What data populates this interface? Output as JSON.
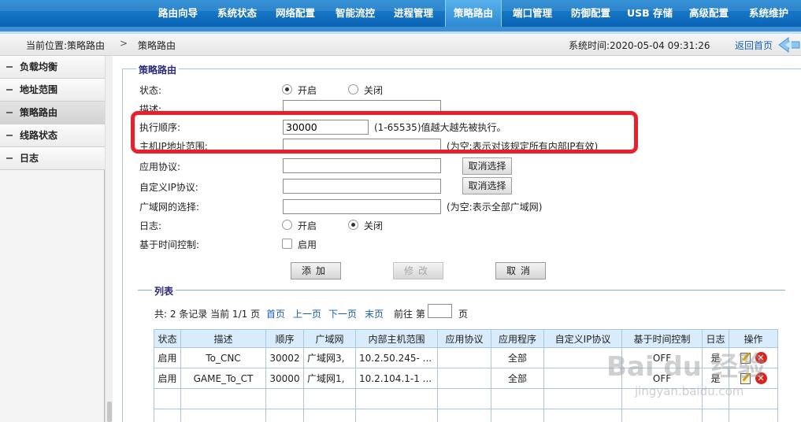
{
  "nav": {
    "items": [
      "路由向导",
      "系统状态",
      "网络配置",
      "智能流控",
      "进程管理",
      "策略路由",
      "端口管理",
      "防御配置",
      "USB 存储",
      "高级配置",
      "系统维护"
    ],
    "active": "策略路由"
  },
  "breadcrumb": {
    "current_label": "当前位置:策略路由",
    "separator": ">",
    "page": "策略路由"
  },
  "system_time": "系统时间:2020-05-04 09:31:26",
  "back_home": "返回首页",
  "sidebar": {
    "items": [
      "负载均衡",
      "地址范围",
      "策略路由",
      "线路状态",
      "日志"
    ],
    "active": "策略路由"
  },
  "form": {
    "legend": "策略路由",
    "status_label": "状态:",
    "status_on": "开启",
    "status_off": "关闭",
    "desc_label": "描述:",
    "desc_value": "",
    "order_label": "执行顺序:",
    "order_value": "30000",
    "order_hint": "(1-65535)值越大越先被执行。",
    "host_ip_label": "主机IP地址范围:",
    "host_ip_value": "",
    "host_ip_hint": "(为空:表示对该规定所有内部IP有效)",
    "app_proto_label": "应用协议:",
    "app_proto_value": "",
    "cancel_select": "取消选择",
    "custom_ip_label": "自定义IP协议:",
    "custom_ip_value": "",
    "wan_label": "广域网的选择:",
    "wan_value": "",
    "wan_hint": "(为空:表示全部广域网)",
    "log_label": "日志:",
    "log_on": "开启",
    "log_off": "关闭",
    "time_ctrl_label": "基于时间控制:",
    "time_ctrl_enable": "启用",
    "add_btn": "添加",
    "modify_btn": "修改",
    "cancel_btn": "取消"
  },
  "list": {
    "legend": "列表",
    "summary": "共: 2 条记录 当前 1/1 页",
    "first": "首页",
    "prev": "上一页",
    "next": "下一页",
    "last": "末页",
    "goto_pre": "前往 第",
    "goto_post": "页",
    "headers": [
      "状态",
      "描述",
      "顺序",
      "广域网",
      "内部主机范围",
      "应用协议",
      "应用程序",
      "自定义IP协议",
      "基于时间控制",
      "日志",
      "操作"
    ],
    "rows": [
      [
        "启用",
        "To_CNC",
        "30002",
        "广域网3,",
        "10.2.50.245- ...",
        "",
        "全部",
        "",
        "OFF",
        "是"
      ],
      [
        "启用",
        "GAME_To_CT",
        "30000",
        "广域网1,",
        "10.2.104.1-1 ...",
        "",
        "全部",
        "",
        "OFF",
        "是"
      ]
    ]
  },
  "watermark": {
    "logo": "Bai du 经验",
    "url": "jingyan.baidu.com"
  }
}
